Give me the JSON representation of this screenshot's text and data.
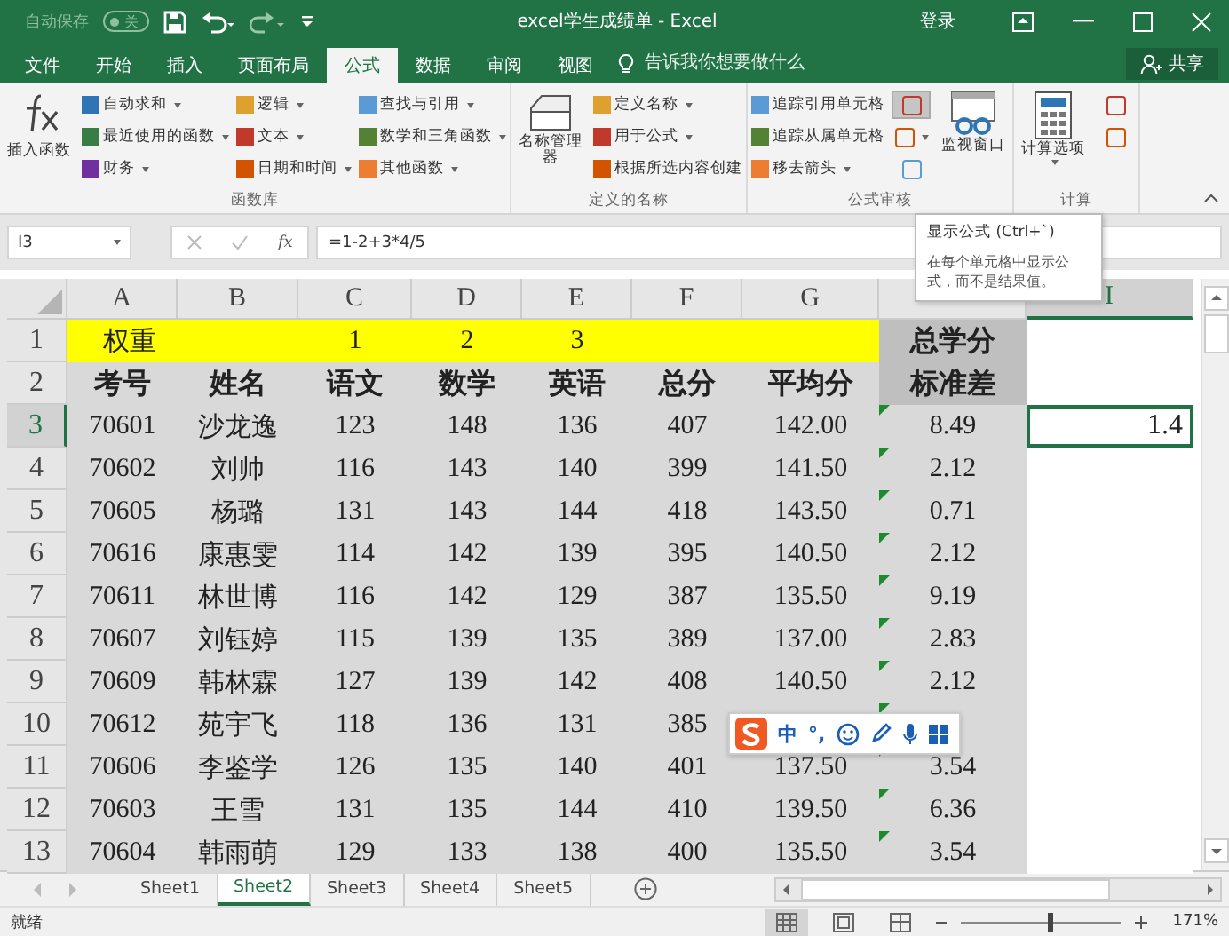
{
  "title_bar": {
    "autosave_label": "自动保存",
    "autosave_toggle": "关",
    "autosave_on": false,
    "title": "excel学生成绩单 - Excel",
    "sign_in": "登录"
  },
  "tabs": [
    {
      "label": "文件",
      "selected": false
    },
    {
      "label": "开始",
      "selected": false
    },
    {
      "label": "插入",
      "selected": false
    },
    {
      "label": "页面布局",
      "selected": false
    },
    {
      "label": "公式",
      "selected": true
    },
    {
      "label": "数据",
      "selected": false
    },
    {
      "label": "审阅",
      "selected": false
    },
    {
      "label": "视图",
      "selected": false
    }
  ],
  "tell_me": {
    "placeholder": "告诉我你想要做什么"
  },
  "share": "共享",
  "ribbon": [
    {
      "name": "函数库",
      "big": [
        {
          "label": "插入函数",
          "kind": "fx"
        }
      ],
      "columns": [
        [
          {
            "label": "自动求和",
            "dropdown": true
          },
          {
            "label": "最近使用的函数",
            "dropdown": true
          },
          {
            "label": "财务",
            "dropdown": true
          }
        ],
        [
          {
            "label": "逻辑",
            "dropdown": true
          },
          {
            "label": "文本",
            "dropdown": true
          },
          {
            "label": "日期和时间",
            "dropdown": true
          }
        ],
        [
          {
            "label": "查找与引用",
            "dropdown": true
          },
          {
            "label": "数学和三角函数",
            "dropdown": true
          },
          {
            "label": "其他函数",
            "dropdown": true
          }
        ]
      ]
    },
    {
      "name": "定义的名称",
      "big": [
        {
          "label": "名称管理器",
          "kind": "names"
        }
      ],
      "columns": [
        [
          {
            "label": "定义名称",
            "dropdown": true
          },
          {
            "label": "用于公式",
            "dropdown": true
          },
          {
            "label": "根据所选内容创建",
            "dropdown": false
          }
        ]
      ]
    },
    {
      "name": "公式审核",
      "columns": [
        [
          {
            "label": "追踪引用单元格",
            "dropdown": false
          },
          {
            "label": "追踪从属单元格",
            "dropdown": false
          },
          {
            "label": "移去箭头",
            "dropdown": true
          }
        ]
      ],
      "tools": [
        {
          "highlighted": true,
          "dropdown": false
        },
        {
          "highlighted": false,
          "dropdown": true
        },
        {
          "highlighted": false,
          "dropdown": false
        }
      ],
      "after": [
        {
          "label": "监视窗口",
          "kind": "watch"
        }
      ]
    },
    {
      "name": "计算",
      "big": [
        {
          "label": "计算选项",
          "kind": "calc"
        }
      ],
      "tools": [
        {
          "highlighted": false,
          "dropdown": false
        },
        {
          "highlighted": false,
          "dropdown": false
        }
      ]
    }
  ],
  "formula_bar": {
    "name_box": "I3",
    "fx": "fx",
    "formula": "=1-2+3*4/5"
  },
  "tooltip": {
    "title": "显示公式 (Ctrl+`)",
    "body": "在每个单元格中显示公式，而不是结果值。"
  },
  "columns": [
    {
      "label": "A",
      "selected": false
    },
    {
      "label": "B",
      "selected": false
    },
    {
      "label": "C",
      "selected": false
    },
    {
      "label": "D",
      "selected": false
    },
    {
      "label": "E",
      "selected": false
    },
    {
      "label": "F",
      "selected": false
    },
    {
      "label": "G",
      "selected": false
    },
    {
      "selected": false
    },
    {
      "label": "I",
      "selected": true
    }
  ],
  "rows": [
    {
      "header": "1",
      "kind": "weights",
      "selected": false,
      "flagged": false,
      "cells": [
        "权重",
        null,
        "1",
        "2",
        "3",
        null,
        null,
        "总学分",
        null
      ]
    },
    {
      "header": "2",
      "kind": "heading",
      "selected": false,
      "flagged": false,
      "cells": [
        "考号",
        "姓名",
        "语文",
        "数学",
        "英语",
        "总分",
        "平均分",
        "标准差",
        null
      ]
    },
    {
      "header": "3",
      "kind": "data",
      "selected": true,
      "flagged": true,
      "cells": [
        "70601",
        "沙龙逸",
        "123",
        "148",
        "136",
        "407",
        "142.00",
        "8.49",
        "1.4"
      ]
    },
    {
      "header": "4",
      "kind": "data",
      "selected": false,
      "flagged": true,
      "cells": [
        "70602",
        "刘帅",
        "116",
        "143",
        "140",
        "399",
        "141.50",
        "2.12",
        null
      ]
    },
    {
      "header": "5",
      "kind": "data",
      "selected": false,
      "flagged": true,
      "cells": [
        "70605",
        "杨璐",
        "131",
        "143",
        "144",
        "418",
        "143.50",
        "0.71",
        null
      ]
    },
    {
      "header": "6",
      "kind": "data",
      "selected": false,
      "flagged": true,
      "cells": [
        "70616",
        "康惠雯",
        "114",
        "142",
        "139",
        "395",
        "140.50",
        "2.12",
        null
      ]
    },
    {
      "header": "7",
      "kind": "data",
      "selected": false,
      "flagged": true,
      "cells": [
        "70611",
        "林世博",
        "116",
        "142",
        "129",
        "387",
        "135.50",
        "9.19",
        null
      ]
    },
    {
      "header": "8",
      "kind": "data",
      "selected": false,
      "flagged": true,
      "cells": [
        "70607",
        "刘钰婷",
        "115",
        "139",
        "135",
        "389",
        "137.00",
        "2.83",
        null
      ]
    },
    {
      "header": "9",
      "kind": "data",
      "selected": false,
      "flagged": true,
      "cells": [
        "70609",
        "韩林霖",
        "127",
        "139",
        "142",
        "408",
        "140.50",
        "2.12",
        null
      ]
    },
    {
      "header": "10",
      "kind": "data",
      "selected": false,
      "flagged": true,
      "cells": [
        "70612",
        "苑宇飞",
        "118",
        "136",
        "131",
        "385",
        null,
        null,
        null
      ]
    },
    {
      "header": "11",
      "kind": "data",
      "selected": false,
      "flagged": true,
      "cells": [
        "70606",
        "李鉴学",
        "126",
        "135",
        "140",
        "401",
        "137.50",
        "3.54",
        null
      ]
    },
    {
      "header": "12",
      "kind": "data",
      "selected": false,
      "flagged": true,
      "cells": [
        "70603",
        "王雪",
        "131",
        "135",
        "144",
        "410",
        "139.50",
        "6.36",
        null
      ]
    },
    {
      "header": "13",
      "kind": "data",
      "selected": false,
      "flagged": true,
      "cells": [
        "70604",
        "韩雨萌",
        "129",
        "133",
        "138",
        "400",
        "135.50",
        "3.54",
        null
      ]
    }
  ],
  "ime_toolbar": {
    "mode": "中",
    "punctuation": "°,"
  },
  "sheets": [
    {
      "label": "Sheet1",
      "selected": false
    },
    {
      "label": "Sheet2",
      "selected": true
    },
    {
      "label": "Sheet3",
      "selected": false
    },
    {
      "label": "Sheet4",
      "selected": false
    },
    {
      "label": "Sheet5",
      "selected": false
    }
  ],
  "status_bar": {
    "status": "就绪",
    "views": [
      {
        "selected": true
      },
      {
        "selected": false
      },
      {
        "selected": false
      }
    ],
    "zoom": {
      "level": 0.55
    },
    "zoom_label": "171%"
  }
}
